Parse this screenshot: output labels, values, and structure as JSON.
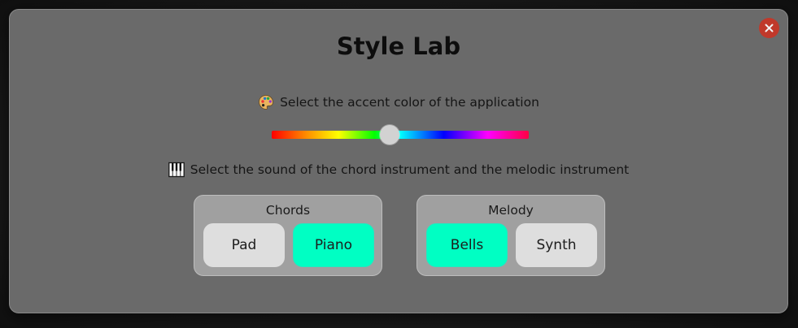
{
  "modal": {
    "title": "Style Lab",
    "close_icon": "close-icon"
  },
  "accent": {
    "label": "Select the accent color of the application",
    "icon": "palette-icon",
    "slider_value_fraction": 0.46
  },
  "sound": {
    "label": "Select the sound of the chord instrument and the melodic instrument",
    "icon": "piano-keys-icon"
  },
  "chords": {
    "title": "Chords",
    "options": [
      {
        "label": "Pad",
        "selected": false
      },
      {
        "label": "Piano",
        "selected": true
      }
    ]
  },
  "melody": {
    "title": "Melody",
    "options": [
      {
        "label": "Bells",
        "selected": true
      },
      {
        "label": "Synth",
        "selected": false
      }
    ]
  },
  "colors": {
    "selected": "#00ffc3",
    "unselected": "#dedede",
    "close": "#c0392b",
    "modal_bg": "#6a6a6a"
  }
}
